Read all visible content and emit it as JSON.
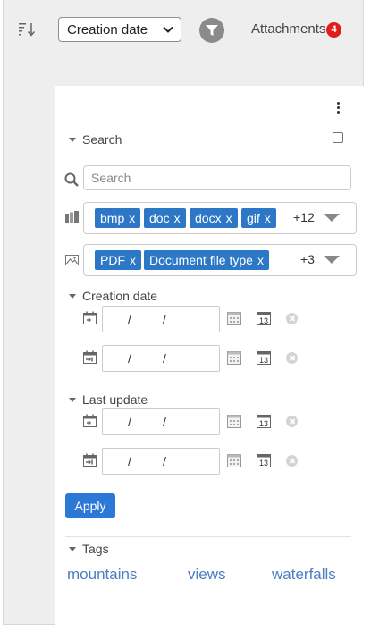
{
  "toolbar": {
    "sort_select": {
      "value": "Creation date"
    },
    "attachments_label": "Attachments",
    "attachments_count": "4"
  },
  "search": {
    "section_label": "Search",
    "placeholder": "Search"
  },
  "file_types": {
    "chips": [
      "bmp",
      "doc",
      "docx",
      "gif"
    ],
    "more": "+12"
  },
  "doc_types": {
    "chips": [
      "PDF",
      "Document file type"
    ],
    "more": "+3"
  },
  "chip_remove": "x",
  "date_sep": "/",
  "creation_date": {
    "label": "Creation date"
  },
  "last_update": {
    "label": "Last update"
  },
  "apply_label": "Apply",
  "tags": {
    "label": "Tags",
    "items": [
      "mountains",
      "views",
      "waterfalls"
    ]
  },
  "colors": {
    "accent": "#2c78c6",
    "badge": "#e21b1b",
    "link": "#4a7fc1"
  }
}
